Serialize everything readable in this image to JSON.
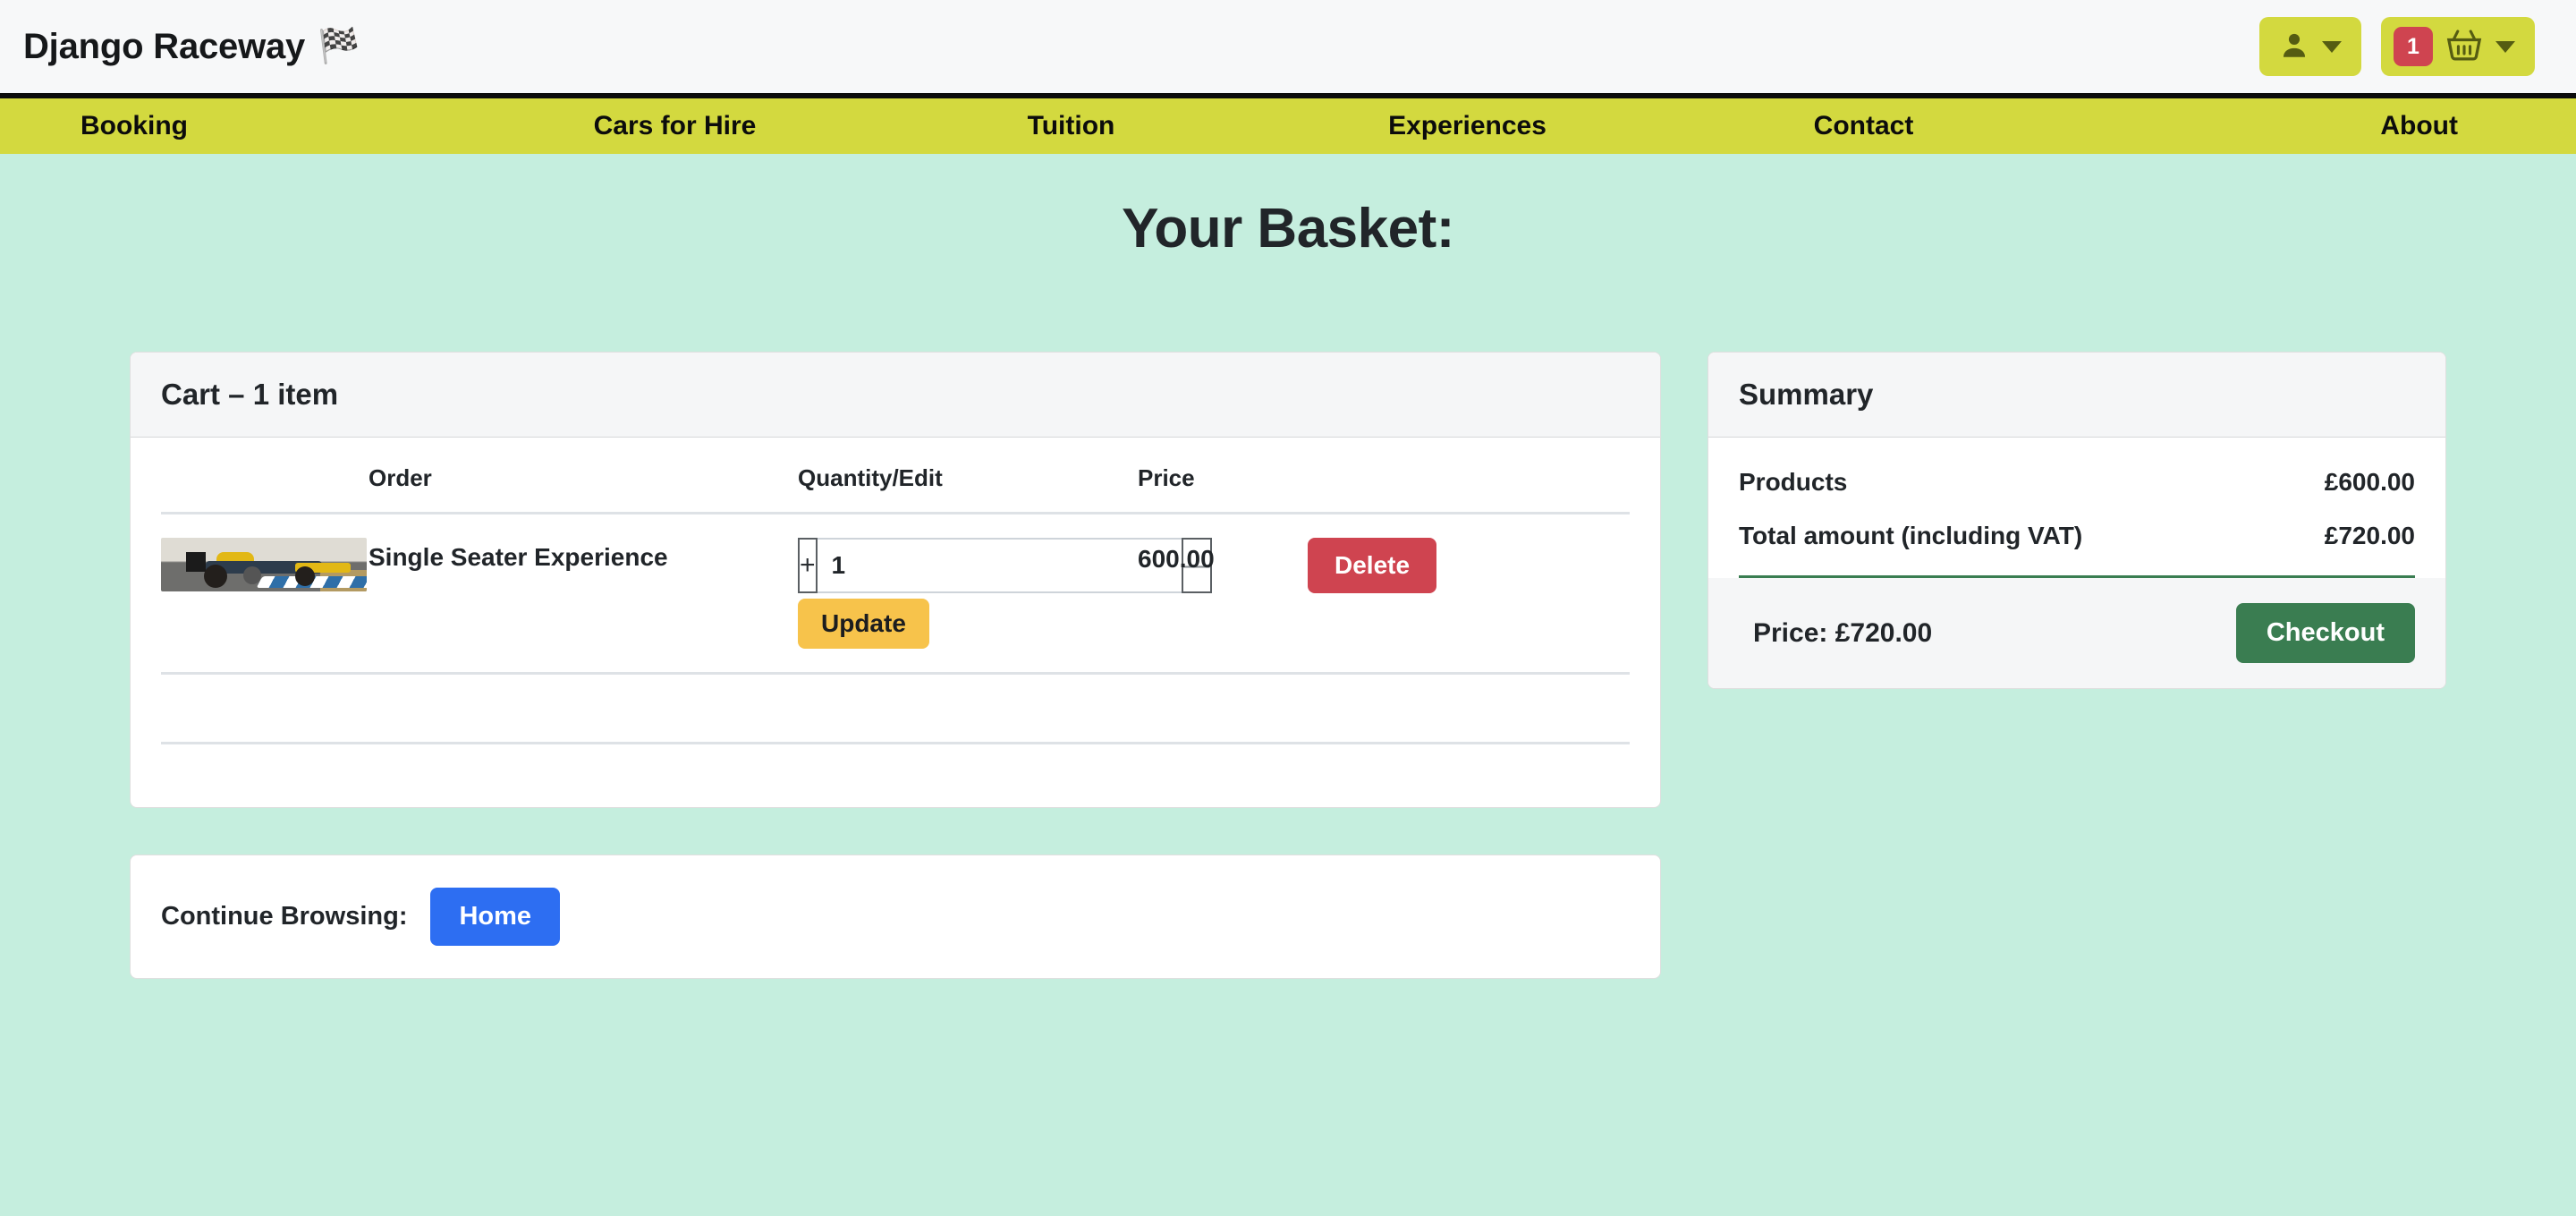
{
  "header": {
    "brand": "Django Raceway",
    "brand_icon": "checkered-flag-icon",
    "account_icon": "user-icon",
    "cart_icon": "basket-icon",
    "cart_count": "1"
  },
  "nav": {
    "items": [
      {
        "label": "Booking"
      },
      {
        "label": "Cars for Hire"
      },
      {
        "label": "Tuition"
      },
      {
        "label": "Experiences"
      },
      {
        "label": "Contact"
      },
      {
        "label": "About"
      }
    ]
  },
  "page": {
    "title": "Your Basket:"
  },
  "cart": {
    "heading": "Cart – 1 item",
    "columns": {
      "image": "",
      "order": "Order",
      "quantity": "Quantity/Edit",
      "price": "Price",
      "action": ""
    },
    "rows": [
      {
        "image_alt": "single-seater-race-car",
        "name": "Single Seater Experience",
        "quantity": "1",
        "increment_label": "+",
        "decrement_label": "—",
        "update_label": "Update",
        "price": "600.00",
        "delete_label": "Delete"
      }
    ]
  },
  "summary": {
    "heading": "Summary",
    "lines": [
      {
        "label": "Products",
        "value": "£600.00"
      },
      {
        "label": "Total amount (including VAT)",
        "value": "£720.00"
      }
    ],
    "total_label": "Price: £720.00",
    "checkout_label": "Checkout"
  },
  "continue": {
    "label": "Continue Browsing:",
    "home_label": "Home"
  },
  "colors": {
    "page_background": "#c5eede",
    "nav_background": "#d3d93f",
    "header_background": "#f7f8f9",
    "badge": "#cf4450",
    "delete": "#cf4450",
    "update": "#f7c34b",
    "checkout": "#3a7d51",
    "home": "#2d6ef2"
  }
}
